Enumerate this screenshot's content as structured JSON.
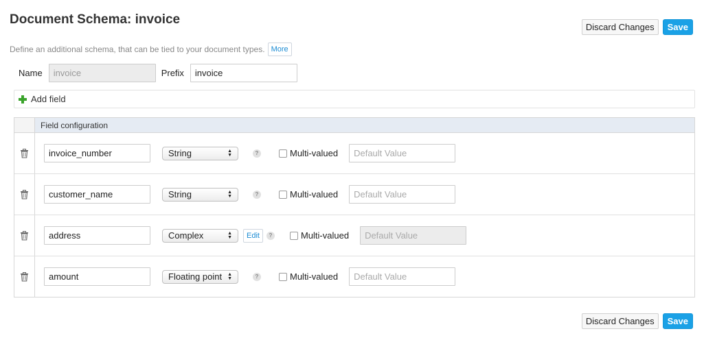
{
  "header": {
    "title": "Document Schema: invoice",
    "description": "Define an additional schema, that can be tied to your document types.",
    "more_label": "More"
  },
  "actions": {
    "discard_label": "Discard Changes",
    "save_label": "Save"
  },
  "form": {
    "name_label": "Name",
    "name_value": "invoice",
    "prefix_label": "Prefix",
    "prefix_value": "invoice"
  },
  "add_field_label": "Add field",
  "table": {
    "header": "Field configuration",
    "multi_label": "Multi-valued",
    "default_placeholder": "Default Value",
    "edit_label": "Edit",
    "help_glyph": "?",
    "rows": [
      {
        "name": "invoice_number",
        "type": "String"
      },
      {
        "name": "customer_name",
        "type": "String"
      },
      {
        "name": "address",
        "type": "Complex"
      },
      {
        "name": "amount",
        "type": "Floating point"
      }
    ]
  },
  "icons": {
    "add": "plus-icon",
    "delete": "trash-icon",
    "help": "help-icon"
  },
  "colors": {
    "save_button": "#1aa1e6",
    "add_icon": "#3aa32b",
    "table_header": "#e5ebf3",
    "link": "#1a8bd3"
  }
}
